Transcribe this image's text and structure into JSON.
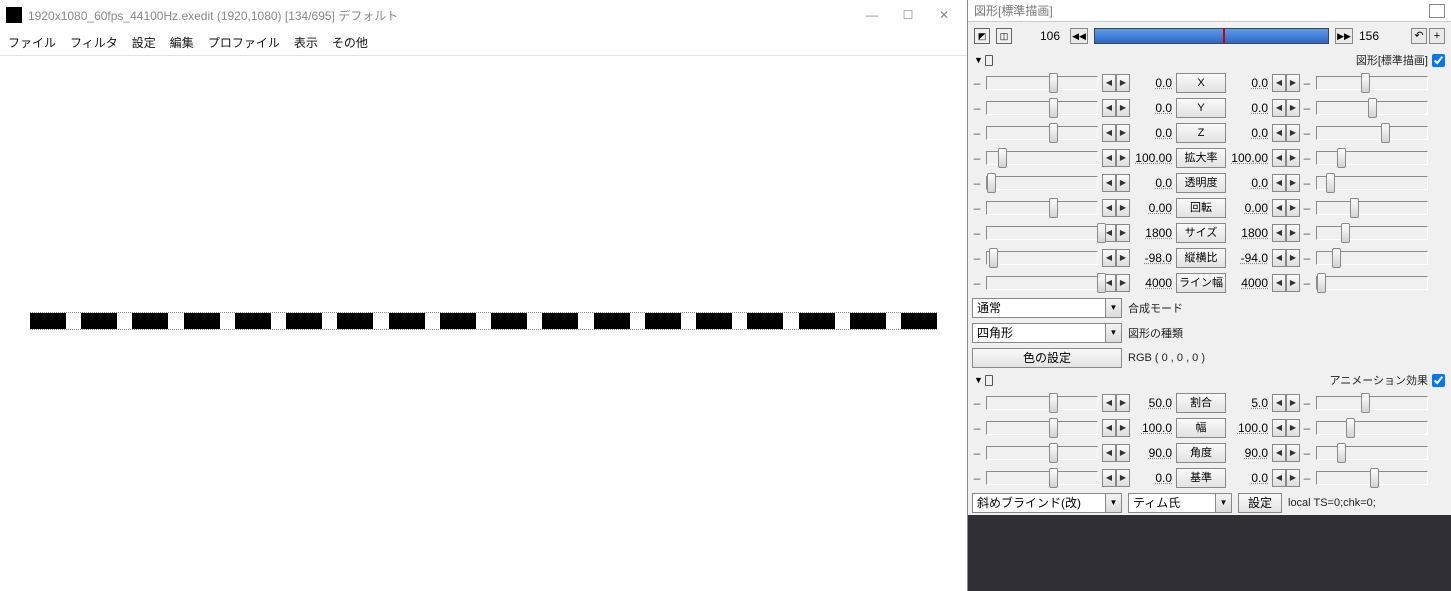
{
  "preview": {
    "title": "1920x1080_60fps_44100Hz.exedit (1920,1080)  [134/695]  デフォルト",
    "menu": [
      "ファイル",
      "フィルタ",
      "設定",
      "編集",
      "プロファイル",
      "表示",
      "その他"
    ]
  },
  "prop": {
    "title": "図形[標準描画]",
    "frame_start": "106",
    "frame_end": "156",
    "section1": {
      "label": "図形[標準描画]"
    },
    "rows1": [
      {
        "v1": "0.0",
        "btn": "X",
        "v2": "0.0",
        "t1": 56,
        "t2": 40
      },
      {
        "v1": "0.0",
        "btn": "Y",
        "v2": "0.0",
        "t1": 56,
        "t2": 46
      },
      {
        "v1": "0.0",
        "btn": "Z",
        "v2": "0.0",
        "t1": 56,
        "t2": 58
      },
      {
        "v1": "100.00",
        "btn": "拡大率",
        "v2": "100.00",
        "t1": 10,
        "t2": 18
      },
      {
        "v1": "0.0",
        "btn": "透明度",
        "v2": "0.0",
        "t1": 0,
        "t2": 8
      },
      {
        "v1": "0.00",
        "btn": "回転",
        "v2": "0.00",
        "t1": 56,
        "t2": 30
      },
      {
        "v1": "1800",
        "btn": "サイズ",
        "v2": "1800",
        "t1": 100,
        "t2": 22
      },
      {
        "v1": "-98.0",
        "btn": "縦横比",
        "v2": "-94.0",
        "t1": 2,
        "t2": 14
      },
      {
        "v1": "4000",
        "btn": "ライン幅",
        "v2": "4000",
        "t1": 100,
        "t2": 0
      }
    ],
    "blend_combo": "通常",
    "blend_label": "合成モード",
    "shape_combo": "四角形",
    "shape_label": "図形の種類",
    "color_btn": "色の設定",
    "color_label": "RGB ( 0 , 0 , 0 )",
    "section2": {
      "label": "アニメーション効果"
    },
    "rows2": [
      {
        "v1": "50.0",
        "btn": "割合",
        "v2": "5.0",
        "t1": 56,
        "t2": 40
      },
      {
        "v1": "100.0",
        "btn": "幅",
        "v2": "100.0",
        "t1": 56,
        "t2": 26
      },
      {
        "v1": "90.0",
        "btn": "角度",
        "v2": "90.0",
        "t1": 56,
        "t2": 18
      },
      {
        "v1": "0.0",
        "btn": "基準",
        "v2": "0.0",
        "t1": 56,
        "t2": 48
      }
    ],
    "anim_combo1": "斜めブラインド(改)",
    "anim_combo2": "ティム氏",
    "cfg_btn": "設定",
    "lua": "local TS=0;chk=0;"
  }
}
